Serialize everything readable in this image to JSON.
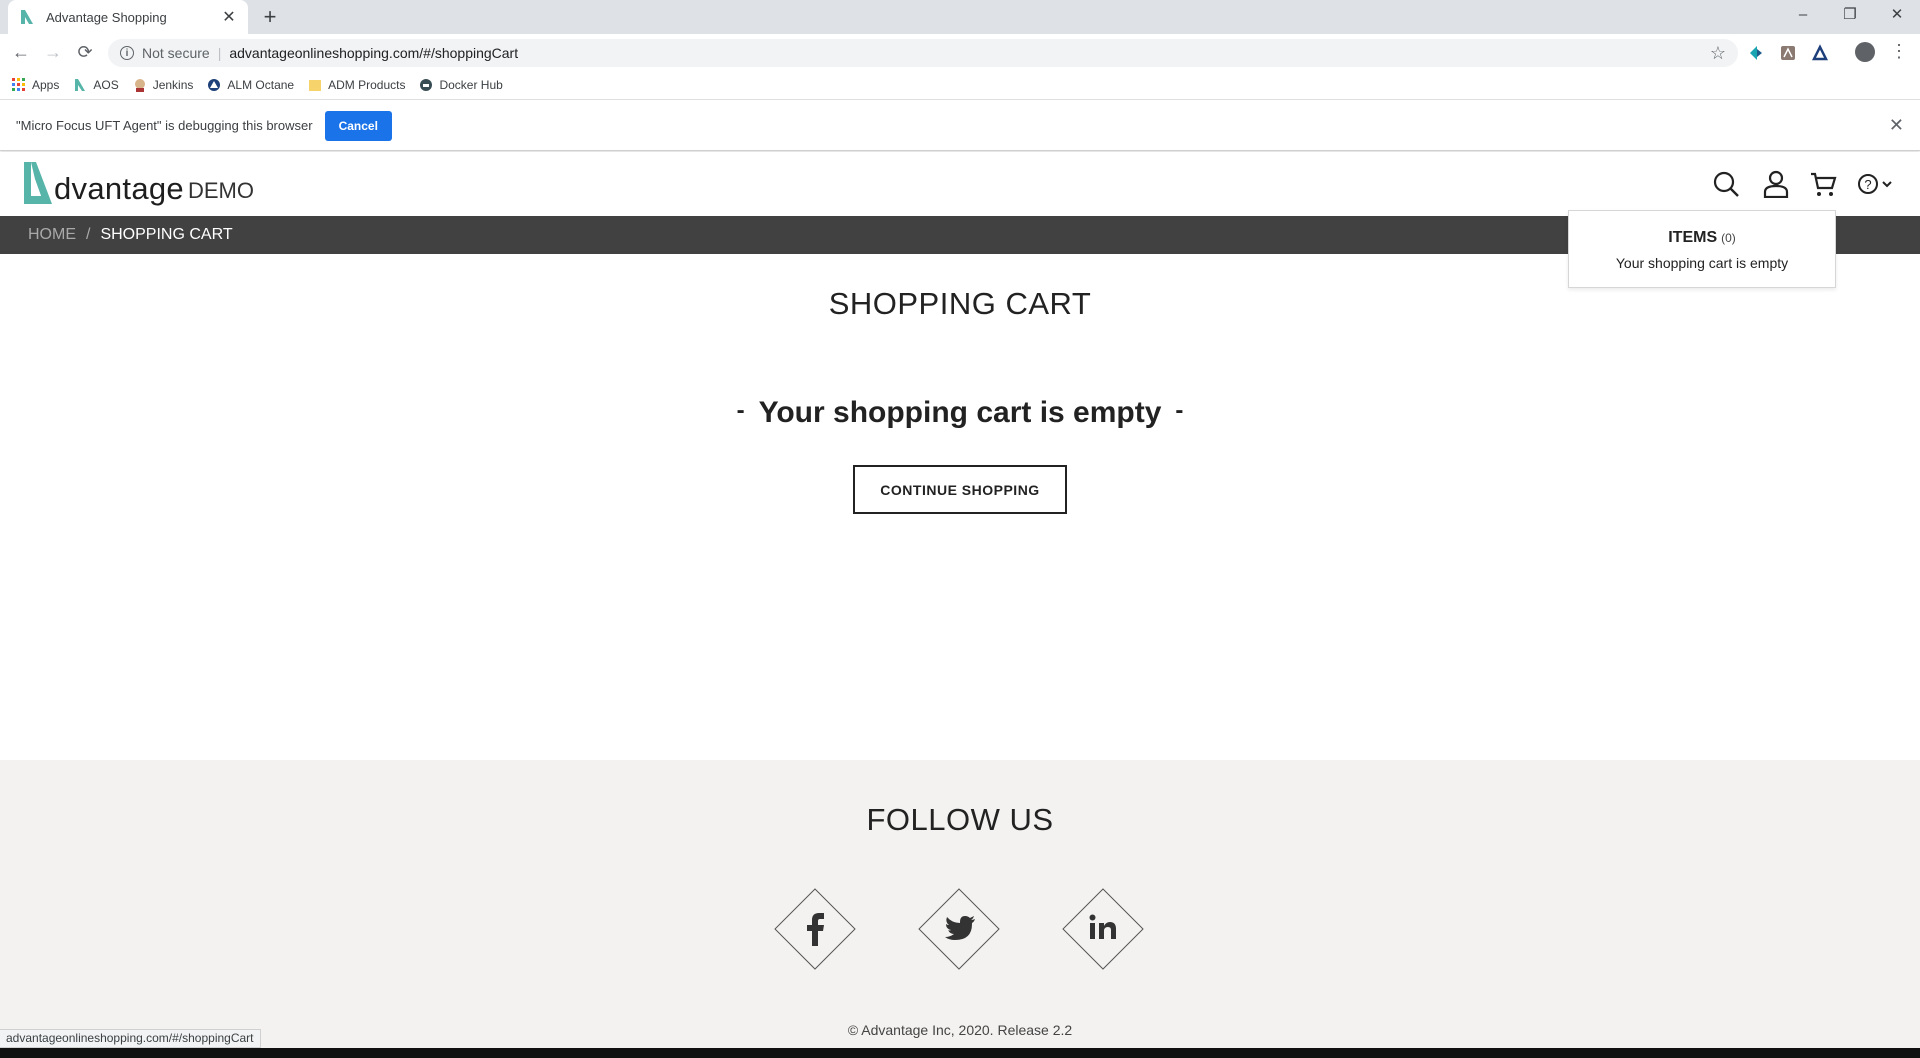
{
  "browser": {
    "tab_title": "Advantage Shopping",
    "security_label": "Not secure",
    "url": "advantageonlineshopping.com/#/shoppingCart",
    "bookmarks": [
      {
        "label": "Apps",
        "icon": "apps-grid-icon"
      },
      {
        "label": "AOS",
        "icon": "aos-logo-icon"
      },
      {
        "label": "Jenkins",
        "icon": "jenkins-icon"
      },
      {
        "label": "ALM Octane",
        "icon": "alm-octane-icon"
      },
      {
        "label": "ADM Products",
        "icon": "folder-icon"
      },
      {
        "label": "Docker Hub",
        "icon": "docker-icon"
      }
    ],
    "infobar_message": "\"Micro Focus UFT Agent\" is debugging this browser",
    "infobar_cancel": "Cancel",
    "status_url": "advantageonlineshopping.com/#/shoppingCart"
  },
  "site": {
    "logo_main": "dvantage",
    "logo_demo": "DEMO",
    "breadcrumb": {
      "home": "HOME",
      "separator": "/",
      "current": "SHOPPING CART"
    },
    "cart_popup": {
      "title": "ITEMS",
      "count": "(0)",
      "message": "Your shopping cart is empty"
    },
    "page_title": "SHOPPING CART",
    "empty_message": "Your shopping cart is empty",
    "empty_dash": "-",
    "continue_button": "CONTINUE SHOPPING",
    "footer": {
      "follow_title": "FOLLOW US",
      "copyright": "© Advantage Inc, 2020. Release 2.2"
    }
  },
  "colors": {
    "accent_teal": "#56b4a9",
    "breadcrumb_bg": "#414141",
    "footer_bg": "#f3f2f0",
    "chrome_blue": "#1a73e8"
  }
}
